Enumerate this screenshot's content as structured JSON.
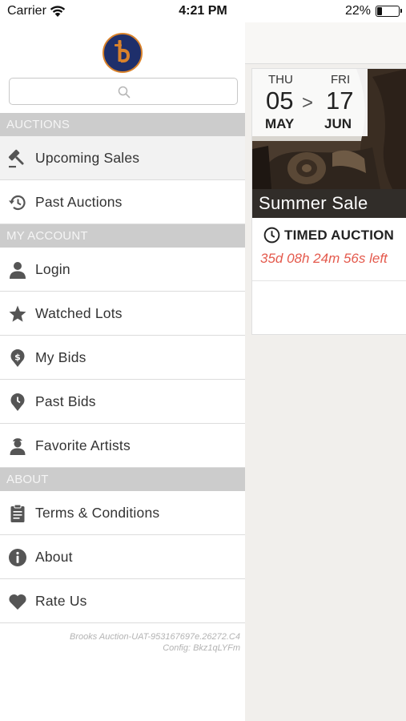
{
  "status_bar": {
    "carrier": "Carrier",
    "time": "4:21 PM",
    "battery_percent": "22%",
    "battery_level": 0.22
  },
  "drawer": {
    "logo_icon": "auction-house-b-logo",
    "search": {
      "placeholder": "",
      "value": ""
    },
    "sections": [
      {
        "header": "AUCTIONS",
        "items": [
          {
            "label": "Upcoming Sales",
            "icon": "gavel-icon",
            "selected": true
          },
          {
            "label": "Past Auctions",
            "icon": "history-icon",
            "selected": false
          }
        ]
      },
      {
        "header": "MY ACCOUNT",
        "items": [
          {
            "label": "Login",
            "icon": "user-icon",
            "selected": false
          },
          {
            "label": "Watched Lots",
            "icon": "star-icon",
            "selected": false
          },
          {
            "label": "My Bids",
            "icon": "dollar-pin-icon",
            "selected": false
          },
          {
            "label": "Past Bids",
            "icon": "clock-pin-icon",
            "selected": false
          },
          {
            "label": "Favorite Artists",
            "icon": "artist-icon",
            "selected": false
          }
        ]
      },
      {
        "header": "ABOUT",
        "items": [
          {
            "label": "Terms & Conditions",
            "icon": "clipboard-icon",
            "selected": false
          },
          {
            "label": "About",
            "icon": "info-icon",
            "selected": false
          },
          {
            "label": "Rate Us",
            "icon": "heart-icon",
            "selected": false
          }
        ]
      }
    ],
    "build_info": {
      "line1": "Brooks Auction-UAT-953167697e.26272.C4",
      "line2": "Config: Bkz1qLYFm"
    }
  },
  "sale_card": {
    "start": {
      "weekday": "THU",
      "day": "05",
      "month": "MAY"
    },
    "separator": ">",
    "end": {
      "weekday": "FRI",
      "day": "17",
      "month": "JUN"
    },
    "title": "Summer Sale",
    "auction_type": "TIMED AUCTION",
    "countdown": "35d 08h 24m 56s left",
    "image_subject": "bronze-sculpture-photo"
  },
  "colors": {
    "section_header_bg": "#cccccc",
    "section_header_text": "#f5f5f5",
    "countdown": "#e45a4d",
    "logo_bg": "#1e2f6b",
    "logo_accent": "#d9822b",
    "icon_gray": "#555555"
  }
}
